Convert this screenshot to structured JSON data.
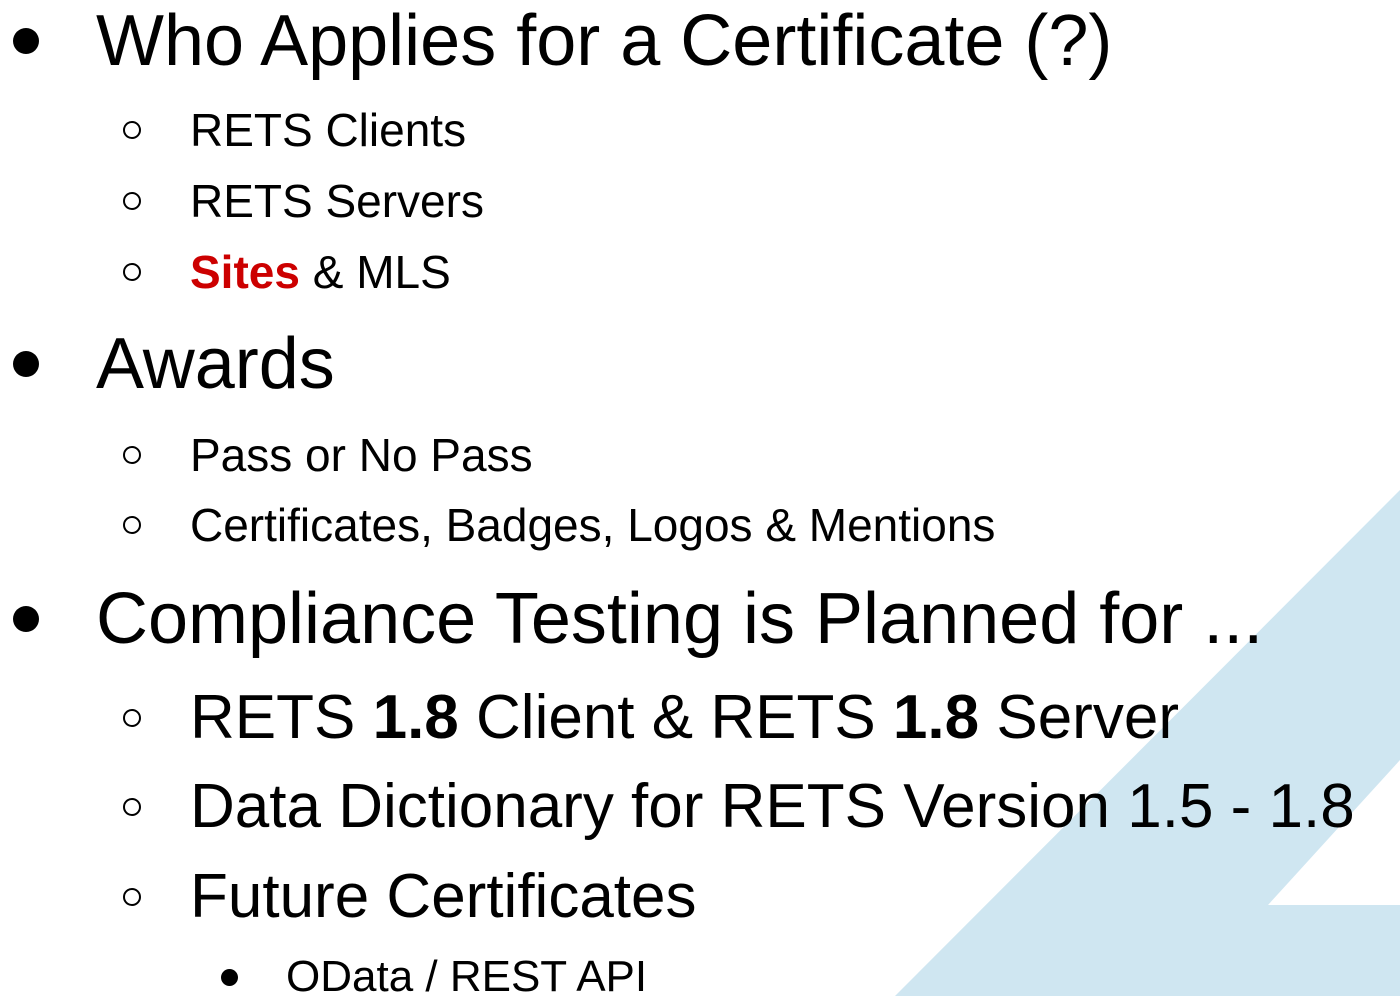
{
  "colors": {
    "accent": "#cc0000",
    "text": "#000000",
    "background_shape": "#cfe6f1"
  },
  "sections": [
    {
      "title": "Who Applies for a Certificate (?)",
      "items": [
        {
          "text": "RETS Clients"
        },
        {
          "text": "RETS Servers"
        },
        {
          "highlight": "Sites",
          "rest": " & MLS"
        }
      ]
    },
    {
      "title": "Awards",
      "items": [
        {
          "text": "Pass or No Pass"
        },
        {
          "text": "Certificates, Badges, Logos & Mentions"
        }
      ]
    },
    {
      "title": "Compliance Testing is Planned for ...",
      "items": [
        {
          "p1": "RETS ",
          "b1": "1.8",
          "p2": " Client & RETS ",
          "b2": "1.8",
          "p3": " Server"
        },
        {
          "text": "Data Dictionary for RETS Version 1.5 - 1.8"
        },
        {
          "text": "Future Certificates",
          "subitems": [
            {
              "text": "OData / REST API"
            }
          ]
        }
      ]
    }
  ]
}
